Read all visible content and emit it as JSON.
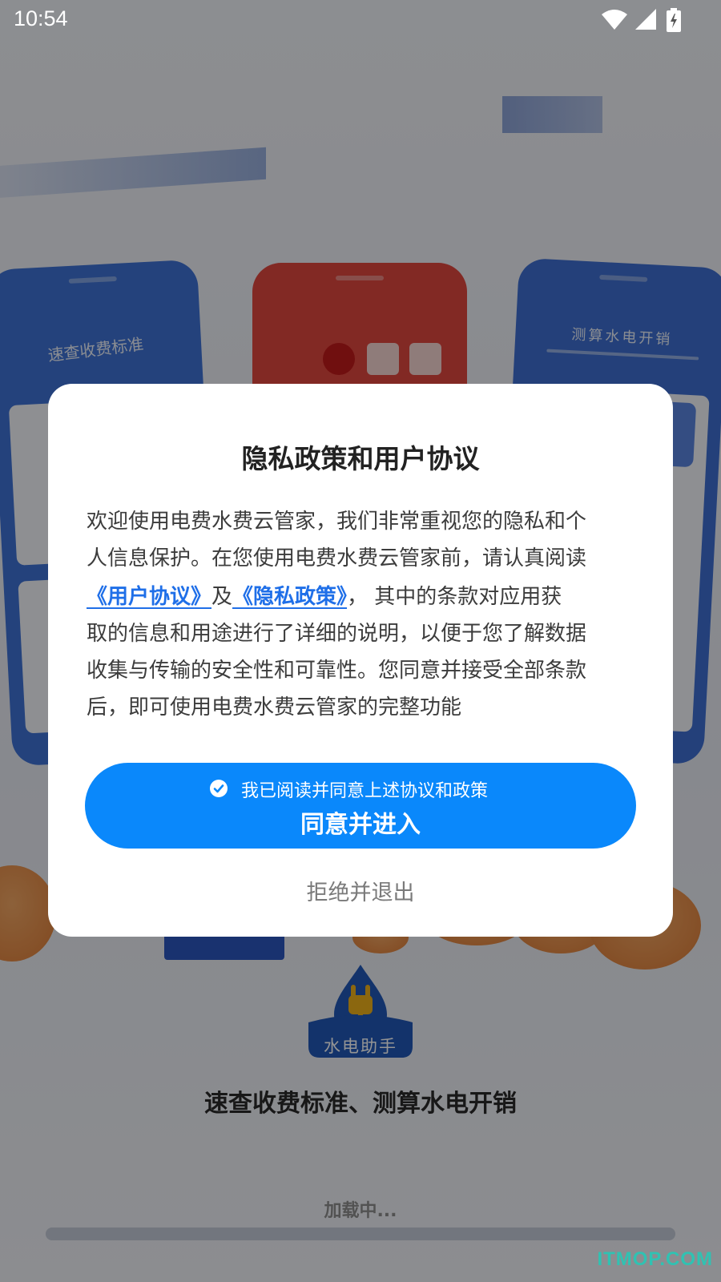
{
  "status_bar": {
    "time": "10:54",
    "icons": [
      "wifi-icon",
      "cell-signal-icon",
      "battery-charging-icon"
    ]
  },
  "background": {
    "left_phone_title": "速查收费标准",
    "right_phone_title": "测算水电开销",
    "logo_text": "水电助手",
    "slogan": "速查收费标准、测算水电开销",
    "loading_text": "加载中..."
  },
  "dialog": {
    "title": "隐私政策和用户协议",
    "body": {
      "line1": "欢迎使用电费水费云管家，我们非常重视您的隐私和个",
      "line2": "人信息保护。在您使用电费水费云管家前，请认真阅读",
      "user_agreement_link": "《用户协议》",
      "and_text": "及",
      "privacy_policy_link": "《隐私政策》",
      "after_links": "， 其中的条款对应用获",
      "line4": "取的信息和用途进行了详细的说明，以便于您了解数据",
      "line5": "收集与传输的安全性和可靠性。您同意并接受全部条款",
      "line6": "后，即可使用电费水费云管家的完整功能"
    },
    "agree_checkbox_label": "我已阅读并同意上述协议和政策",
    "agree_checked": true,
    "agree_button_label": "同意并进入",
    "reject_button_label": "拒绝并退出"
  },
  "watermark": "ITMOP.COM",
  "colors": {
    "primary_button": "#0a88fb",
    "link": "#1f6fe8",
    "logo_blue": "#2258b8",
    "logo_plug": "#f0b21a",
    "watermark": "#30c2b2"
  }
}
